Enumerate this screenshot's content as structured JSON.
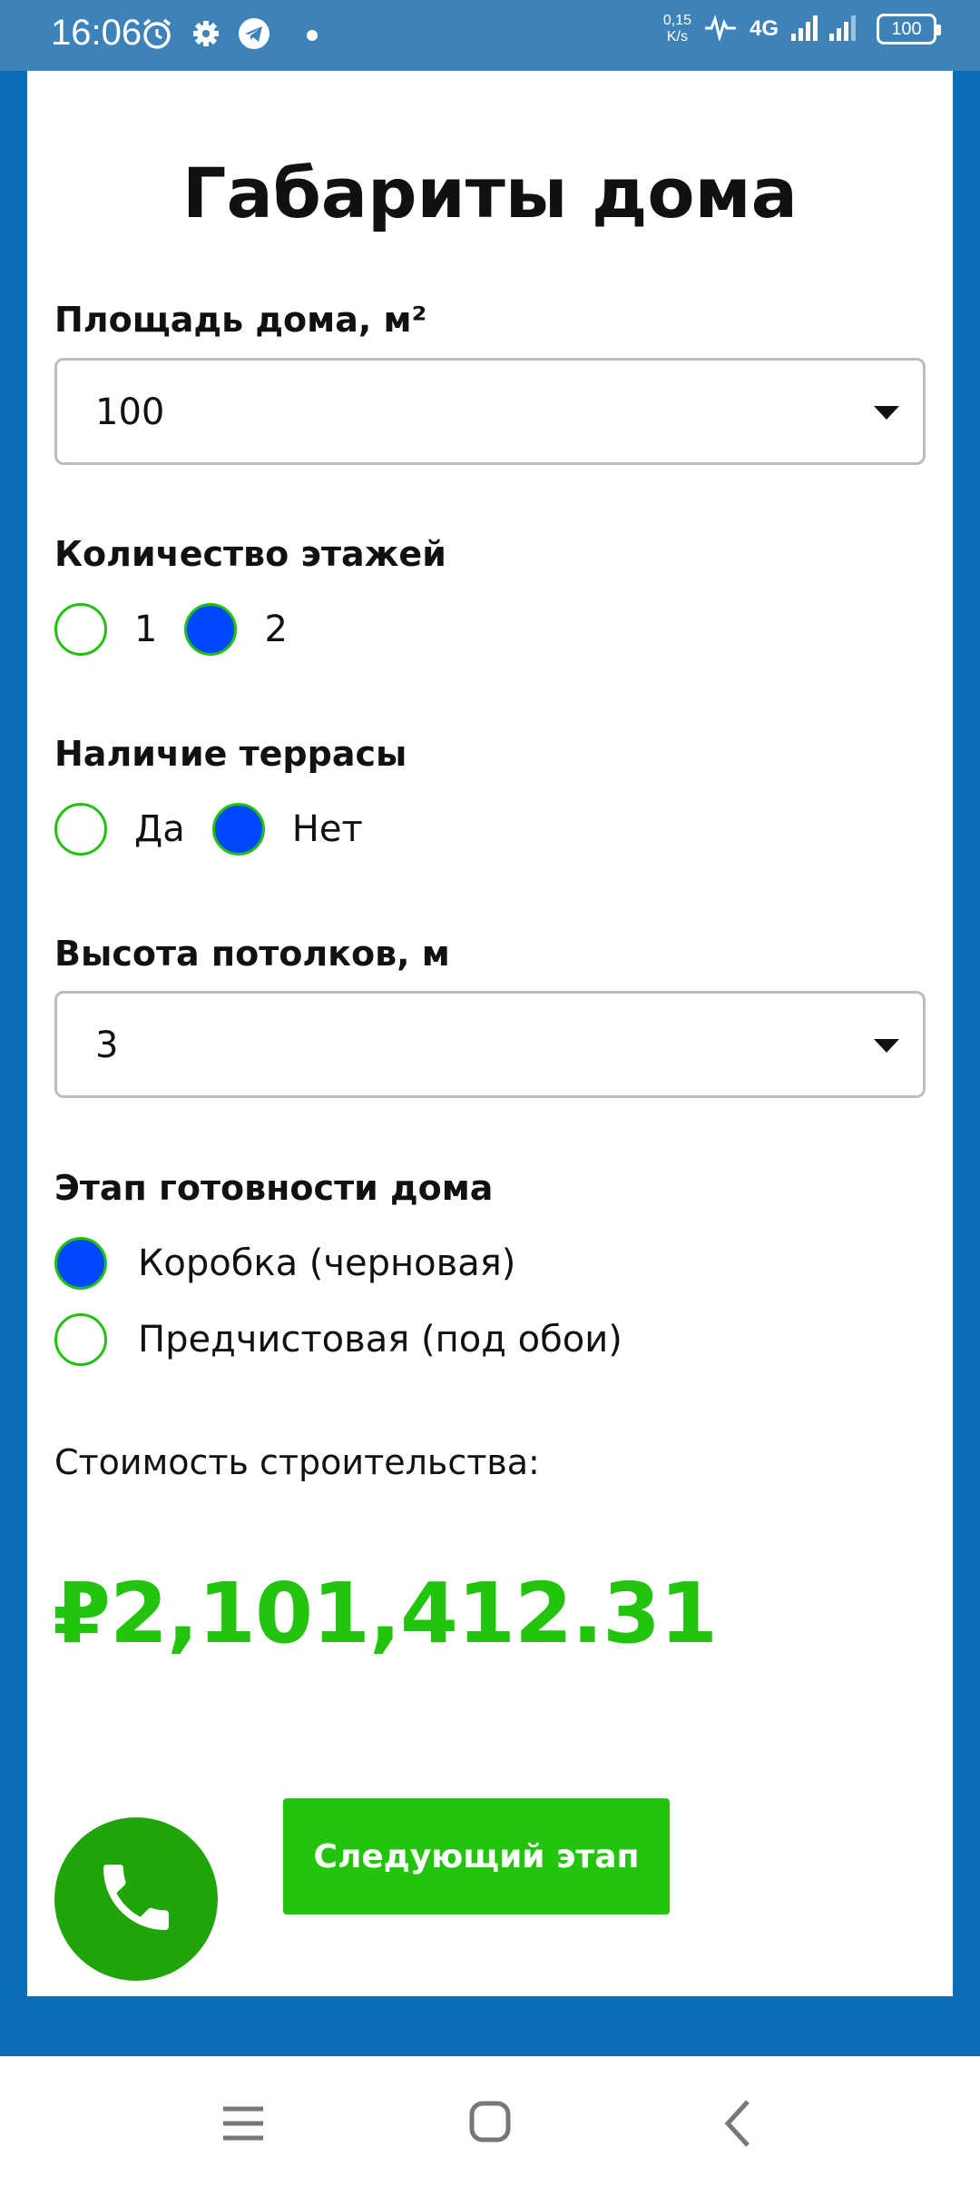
{
  "status_bar": {
    "time": "16:06",
    "net_speed_value": "0,15",
    "net_speed_unit": "K/s",
    "network": "4G",
    "battery": "100",
    "icons": [
      "alarm-icon",
      "gear-icon",
      "telegram-icon",
      "activity-icon",
      "signal-icon",
      "battery-icon"
    ]
  },
  "page": {
    "title": "Габариты дома"
  },
  "area": {
    "label": "Площадь дома, м²",
    "value": "100"
  },
  "floors": {
    "label": "Количество этажей",
    "options": [
      "1",
      "2"
    ],
    "selected": "2"
  },
  "terrace": {
    "label": "Наличие террасы",
    "options": [
      "Да",
      "Нет"
    ],
    "selected": "Нет"
  },
  "ceiling": {
    "label": "Высота потолков, м",
    "value": "3"
  },
  "stage": {
    "label": "Этап готовности дома",
    "options": [
      "Коробка (черновая)",
      "Предчистовая (под обои)"
    ],
    "selected": "Коробка (черновая)"
  },
  "cost": {
    "label": "Стоимость строительства:",
    "value": "₽2,101,412.31"
  },
  "buttons": {
    "next": "Следующий этап"
  },
  "colors": {
    "accent_green": "#23c40e",
    "selected_blue": "#0047ff",
    "background_blue": "#0a6db8"
  }
}
